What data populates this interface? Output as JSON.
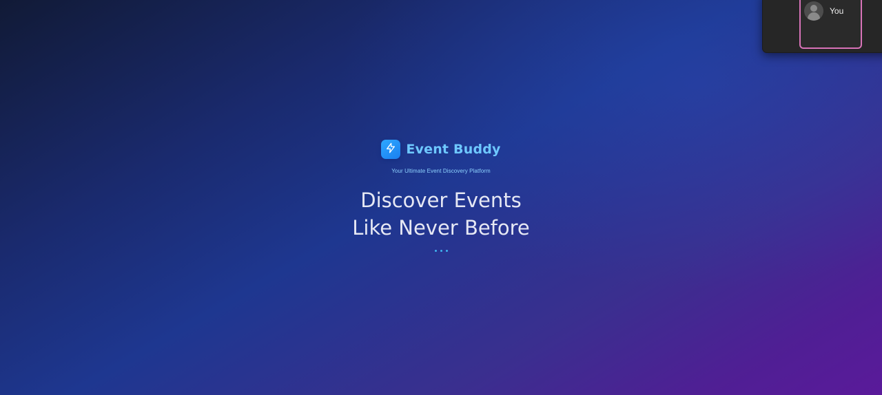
{
  "brand": {
    "name": "Event Buddy",
    "tagline": "Your Ultimate Event Discovery Platform",
    "logo_icon": "lightning-bolt-icon",
    "accent_color": "#6ec8ff"
  },
  "hero": {
    "headline_line1": "Discover Events",
    "headline_line2": "Like Never Before"
  },
  "loading_indicator": {
    "dot_count": 3,
    "color": "#3fb4f0"
  },
  "call_overlay": {
    "self_label": "You",
    "avatar_icon": "user-avatar-icon",
    "highlight_color": "#d873b8"
  }
}
